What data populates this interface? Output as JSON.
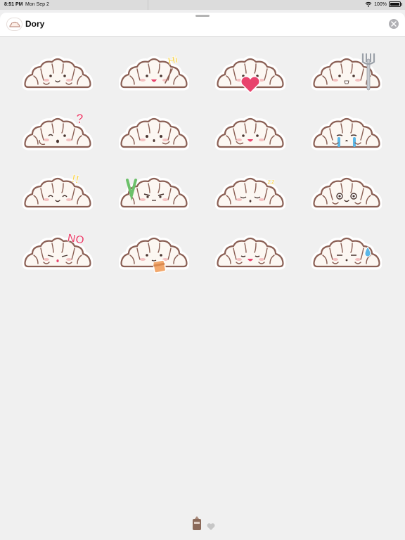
{
  "status": {
    "time": "8:51 PM",
    "date": "Mon Sep 2",
    "battery": "100%"
  },
  "header": {
    "title": "Dory"
  },
  "stickers": [
    {
      "id": "calm",
      "accent": ""
    },
    {
      "id": "hi",
      "accent": "Hi"
    },
    {
      "id": "heart",
      "accent": ""
    },
    {
      "id": "fork",
      "accent": ""
    },
    {
      "id": "question",
      "accent": "?"
    },
    {
      "id": "sleepy",
      "accent": ""
    },
    {
      "id": "smile",
      "accent": ""
    },
    {
      "id": "cry",
      "accent": ""
    },
    {
      "id": "excited",
      "accent": "!!"
    },
    {
      "id": "victory",
      "accent": ""
    },
    {
      "id": "zzz",
      "accent": "zz"
    },
    {
      "id": "dizzy",
      "accent": ""
    },
    {
      "id": "no",
      "accent": "NO"
    },
    {
      "id": "drink",
      "accent": ""
    },
    {
      "id": "shy",
      "accent": ""
    },
    {
      "id": "sweat",
      "accent": ""
    }
  ],
  "colors": {
    "outline": "#8a5f54",
    "fill": "#fcf7f2",
    "blush": "#f1a9ad",
    "accent_pink": "#e8436c",
    "accent_yellow": "#f8d44c"
  },
  "bottom_bar": {
    "icons": [
      "sticker-pack-icon",
      "heart-icon"
    ]
  }
}
